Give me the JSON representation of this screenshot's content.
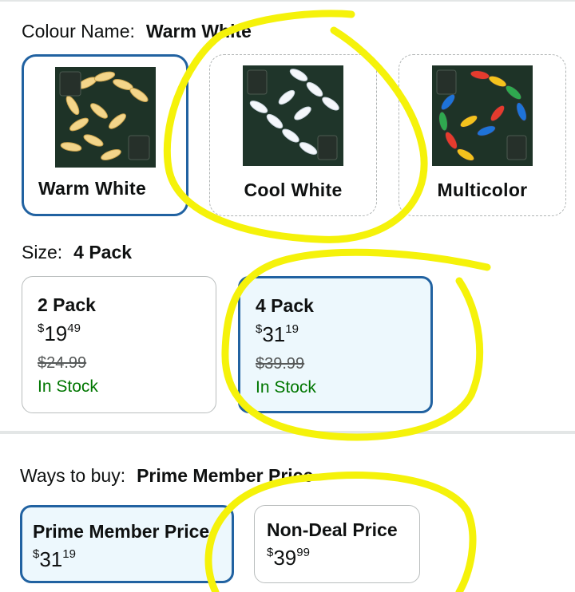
{
  "colour": {
    "label": "Colour Name:",
    "selected": "Warm White",
    "swatches": [
      {
        "name": "Warm White"
      },
      {
        "name": "Cool White"
      },
      {
        "name": "Multicolor"
      }
    ]
  },
  "size": {
    "label": "Size:",
    "selected": "4 Pack",
    "options": [
      {
        "title": "2 Pack",
        "currency": "$",
        "whole": "19",
        "fraction": "49",
        "list_price": "$24.99",
        "availability": "In Stock"
      },
      {
        "title": "4 Pack",
        "currency": "$",
        "whole": "31",
        "fraction": "19",
        "list_price": "$39.99",
        "availability": "In Stock"
      }
    ]
  },
  "ways_to_buy": {
    "label": "Ways to buy:",
    "selected": "Prime Member Price",
    "options": [
      {
        "title": "Prime Member Price",
        "currency": "$",
        "whole": "31",
        "fraction": "19"
      },
      {
        "title": "Non-Deal Price",
        "currency": "$",
        "whole": "39",
        "fraction": "99"
      }
    ]
  },
  "colors": {
    "selected_border": "#2162a1",
    "selected_bg": "#edf8fd",
    "in_stock": "#007600",
    "annotation": "#f5f20a"
  }
}
